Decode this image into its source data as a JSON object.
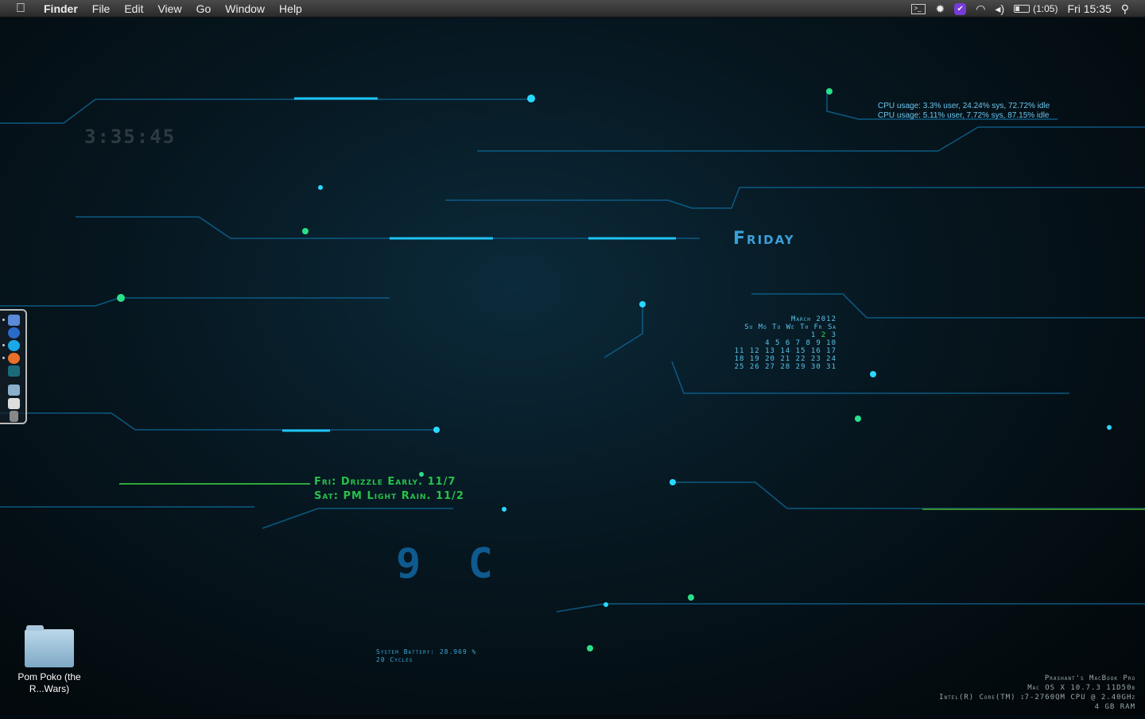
{
  "menubar": {
    "apple": "",
    "app": "Finder",
    "items": [
      "File",
      "Edit",
      "View",
      "Go",
      "Window",
      "Help"
    ],
    "status": {
      "icons": [
        "terminal-icon",
        "gear-icon",
        "task-check-icon",
        "wifi-icon",
        "volume-icon",
        "battery-icon"
      ],
      "battery_time": "(1:05)",
      "clock": "Fri 15:35"
    }
  },
  "desktop": {
    "clock": "3:35:45",
    "cpu": [
      "CPU usage: 3.3% user, 24.24% sys, 72.72% idle",
      "CPU usage: 5.11% user, 7.72% sys, 87.15% idle"
    ],
    "day": "Friday",
    "calendar": {
      "title": "March 2012",
      "header": "Su Mo Tu We Th Fr Sa",
      "today": "2",
      "rows": [
        "1",
        "4 5 6 7 8 9 10",
        "11 12 13 14 15 16 17",
        "18 19 20 21 22 23 24",
        "25 26 27 28 29 30 31"
      ],
      "row1_end": "3"
    },
    "weather": [
      "Fri: Drizzle Early. 11/7",
      "Sat: PM Light Rain. 11/2"
    ],
    "temperature": "9 C",
    "battery": [
      "System Battery: 28.969 %",
      "20 Cycles"
    ],
    "system": [
      "Prashant's MacBook Pro",
      "Mac OS X 10.7.3 11D50b",
      "Intel(R) Core(TM) i7-2760QM CPU @ 2.40GHz",
      "4 GB RAM"
    ],
    "folder": {
      "label": "Pom Poko (the R...Wars)"
    }
  },
  "dock": {
    "items": [
      "finder",
      "itunes",
      "skype",
      "firefox",
      "app",
      "folder",
      "preview",
      "trash"
    ]
  },
  "colors": {
    "accent": "#3aa0d8",
    "weather": "#27c24a"
  }
}
